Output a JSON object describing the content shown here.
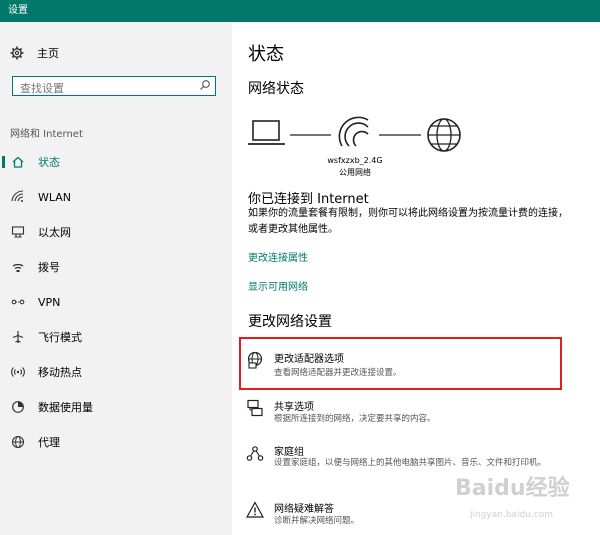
{
  "window": {
    "title": "设置"
  },
  "sidebar": {
    "home_label": "主页",
    "search_placeholder": "查找设置",
    "section_label": "网络和 Internet",
    "items": [
      {
        "label": "状态",
        "icon": "home-status-icon",
        "active": true
      },
      {
        "label": "WLAN",
        "icon": "wifi-icon"
      },
      {
        "label": "以太网",
        "icon": "ethernet-icon"
      },
      {
        "label": "拨号",
        "icon": "dialup-icon"
      },
      {
        "label": "VPN",
        "icon": "vpn-icon"
      },
      {
        "label": "飞行模式",
        "icon": "airplane-icon"
      },
      {
        "label": "移动热点",
        "icon": "hotspot-icon"
      },
      {
        "label": "数据使用量",
        "icon": "data-usage-icon"
      },
      {
        "label": "代理",
        "icon": "globe-icon"
      }
    ]
  },
  "main": {
    "page_title": "状态",
    "network_status_heading": "网络状态",
    "network_name": "wsfxzxb_2.4G",
    "network_type": "公用网络",
    "connected_heading": "你已连接到 Internet",
    "connected_desc": "如果你的流量套餐有限制，则你可以将此网络设置为按流量计费的连接，或者更改其他属性。",
    "link_change_props": "更改连接属性",
    "link_show_networks": "显示可用网络",
    "change_settings_heading": "更改网络设置",
    "options": [
      {
        "title": "更改适配器选项",
        "desc": "查看网络适配器并更改连接设置。",
        "icon": "adapter-icon",
        "highlighted": true
      },
      {
        "title": "共享选项",
        "desc": "根据所连接到的网络，决定要共享的内容。",
        "icon": "sharing-icon"
      },
      {
        "title": "家庭组",
        "desc": "设置家庭组，以便与网络上的其他电脑共享图片、音乐、文件和打印机。",
        "icon": "homegroup-icon"
      },
      {
        "title": "网络疑难解答",
        "desc": "诊断并解决网络问题。",
        "icon": "troubleshoot-icon"
      }
    ]
  },
  "watermark": {
    "text": "Baidu经验",
    "url": "jingyan.baidu.com"
  },
  "colors": {
    "accent": "#00796b",
    "highlight": "#e41c1c"
  }
}
